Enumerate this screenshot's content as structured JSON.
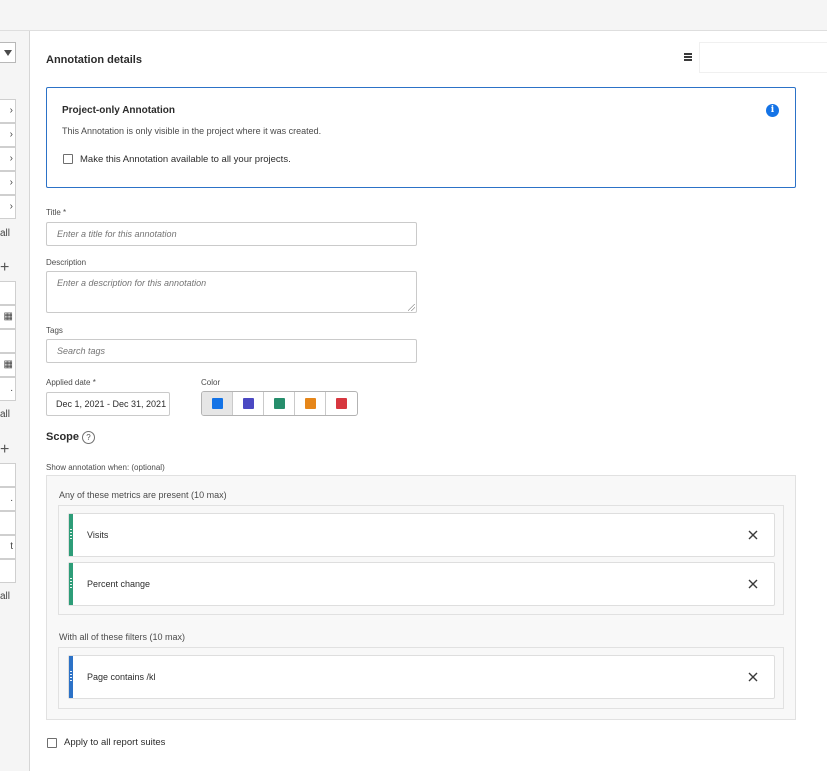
{
  "colors": {
    "accent": "#1473e6",
    "metric_bar": "#2d9d78",
    "filter_bar": "#2c72c7"
  },
  "left_rail": {
    "texts": [
      "all",
      "all",
      "t",
      "all"
    ]
  },
  "panel": {
    "title": "Annotation details"
  },
  "info": {
    "title": "Project-only Annotation",
    "text": "This Annotation is only visible in the project where it was created.",
    "checkbox_label": "Make this Annotation available to all your projects.",
    "checked": false,
    "icon": "info-icon"
  },
  "form": {
    "title_label": "Title *",
    "title_placeholder": "Enter a title for this annotation",
    "description_label": "Description",
    "description_placeholder": "Enter a description for this annotation",
    "tags_label": "Tags",
    "tags_placeholder": "Search tags",
    "date_label": "Applied date *",
    "date_value": "Dec 1, 2021 - Dec 31, 2021",
    "color_label": "Color",
    "colors": [
      {
        "name": "blue",
        "hex": "#1473e6",
        "selected": true
      },
      {
        "name": "indigo",
        "hex": "#4b49c3",
        "selected": false
      },
      {
        "name": "green",
        "hex": "#268e6c",
        "selected": false
      },
      {
        "name": "orange",
        "hex": "#e68619",
        "selected": false
      },
      {
        "name": "red",
        "hex": "#d7373f",
        "selected": false
      }
    ]
  },
  "scope": {
    "title": "Scope",
    "help_icon": "?",
    "subtitle": "Show annotation when: (optional)",
    "metrics_label": "Any of these metrics are present (10 max)",
    "metrics": [
      {
        "label": "Visits"
      },
      {
        "label": "Percent change"
      }
    ],
    "filters_label": "With all of these filters (10 max)",
    "filters": [
      {
        "label": "Page contains /kl"
      }
    ]
  },
  "footer": {
    "apply_label": "Apply to all report suites",
    "checked": false
  }
}
